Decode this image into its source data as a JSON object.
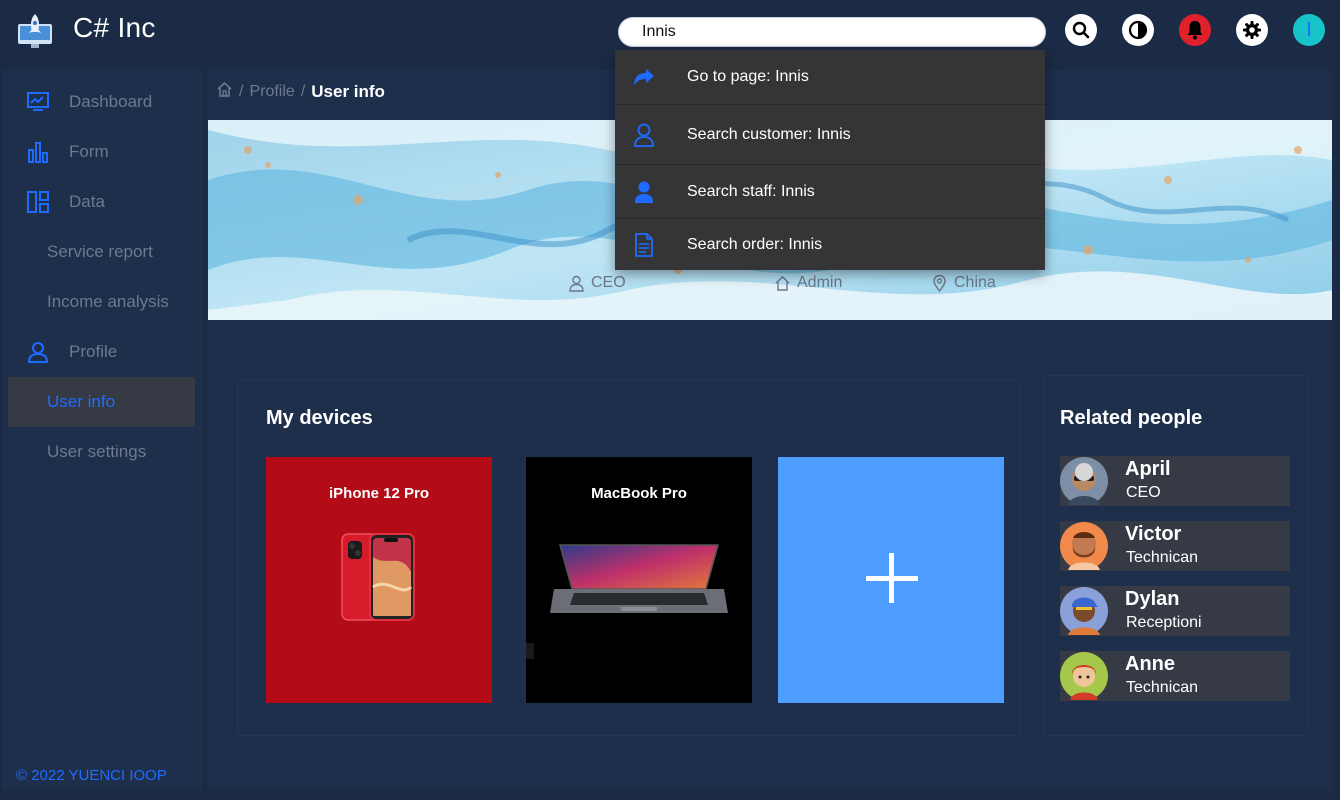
{
  "app": {
    "title": "C# Inc"
  },
  "search": {
    "value": "Innis",
    "placeholder": ""
  },
  "toolbar": {
    "search_icon": "search-icon",
    "theme_icon": "contrast-icon",
    "notifications_icon": "bell-icon",
    "settings_icon": "gear-icon",
    "avatar_initial": "I"
  },
  "sidebar": {
    "items": [
      {
        "label": "Dashboard",
        "icon": "monitor-chart-icon"
      },
      {
        "label": "Form",
        "icon": "bar-chart-icon"
      },
      {
        "label": "Data",
        "icon": "layout-icon"
      },
      {
        "label": "Service report"
      },
      {
        "label": "Income analysis"
      },
      {
        "label": "Profile",
        "icon": "user-icon"
      },
      {
        "label": "User info",
        "active": true
      },
      {
        "label": "User settings"
      }
    ],
    "footer": "© 2022 YUENCI IOOP"
  },
  "breadcrumb": {
    "sep1": "/",
    "profile": "Profile",
    "sep2": "/",
    "current": "User info"
  },
  "banner": {
    "role": "CEO",
    "group": "Admin",
    "location": "China"
  },
  "devices": {
    "title": "My devices",
    "items": [
      {
        "name": "iPhone 12 Pro",
        "color": "#b30c17"
      },
      {
        "name": "MacBook Pro",
        "color": "#000000"
      }
    ],
    "add_color": "#4d9eff"
  },
  "people": {
    "title": "Related people",
    "items": [
      {
        "name": "April",
        "role": "CEO",
        "color": "#7d8fa6"
      },
      {
        "name": "Victor",
        "role": "Technican",
        "color": "#f0894a"
      },
      {
        "name": "Dylan",
        "role": "Receptioni",
        "color": "#8aa0d8"
      },
      {
        "name": "Anne",
        "role": "Technican",
        "color": "#a6c84a"
      }
    ]
  },
  "dropdown": {
    "items": [
      {
        "label": "Go to page: Innis",
        "icon": "share-arrow-icon"
      },
      {
        "label": "Search customer: Innis",
        "icon": "user-outline-icon"
      },
      {
        "label": "Search staff: Innis",
        "icon": "user-filled-icon"
      },
      {
        "label": "Search order: Innis",
        "icon": "document-icon"
      }
    ]
  },
  "colors": {
    "accent": "#1e6cff",
    "background": "#1b2b45",
    "panel": "#1e2f4c"
  }
}
